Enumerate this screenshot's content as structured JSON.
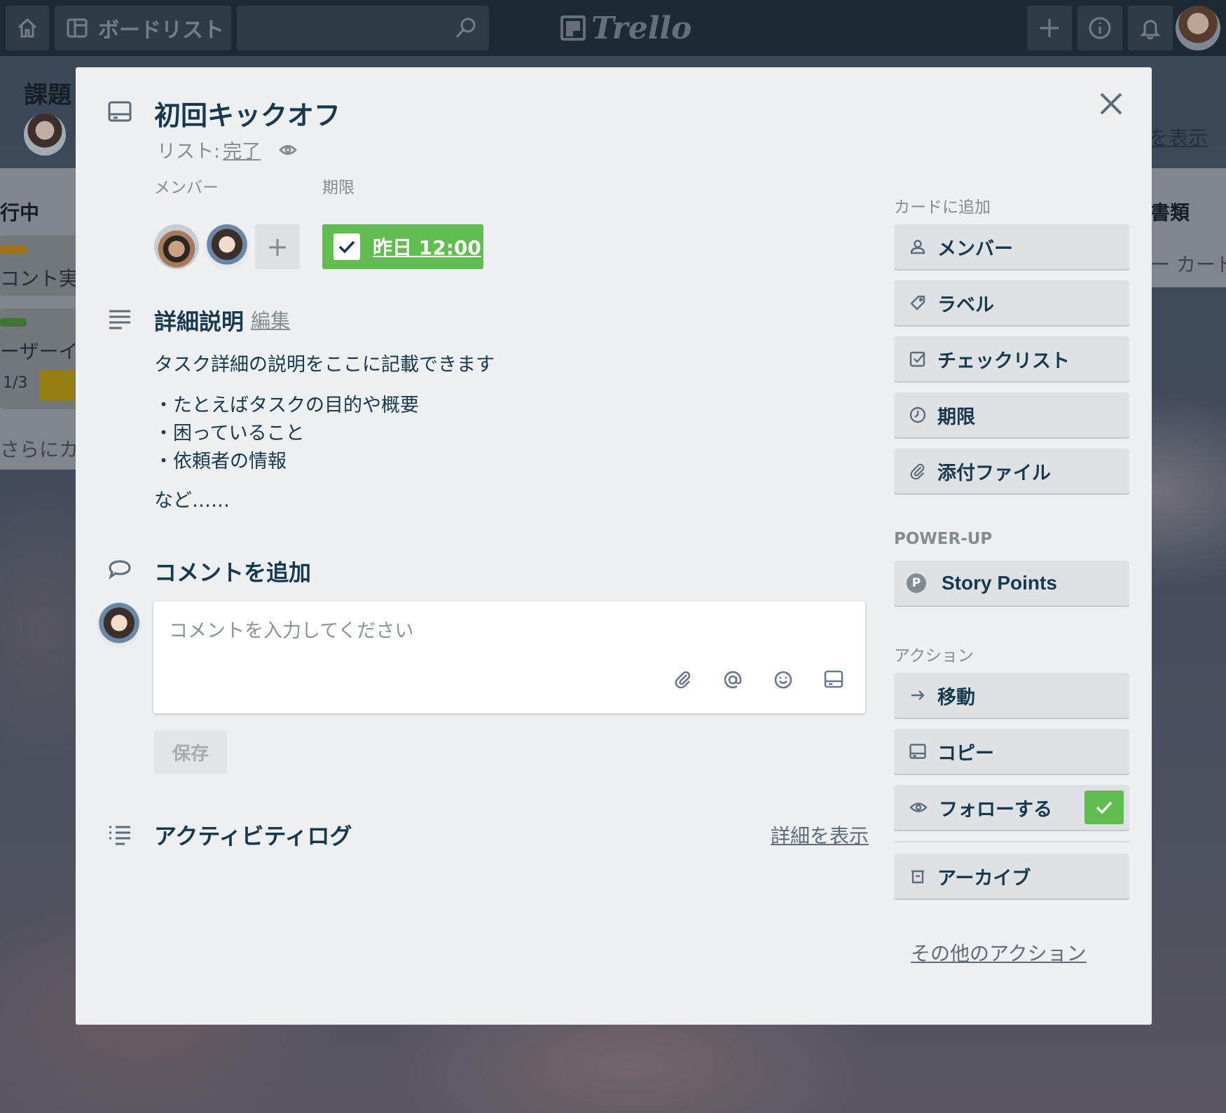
{
  "topbar": {
    "board_list_label": "ボードリスト",
    "logo_text": "Trello",
    "icons": [
      "home-icon",
      "board-icon",
      "search-icon",
      "plus-icon",
      "info-icon",
      "bell-icon"
    ]
  },
  "background": {
    "board_title": "課題",
    "show_menu_link": "を表示",
    "list_left_title": "行中",
    "list_left_card1": "コント実業",
    "list_left_card2": "ーザーイン",
    "list_left_badge": "1/3",
    "list_left_add": "さらにカー",
    "list_right_title": "書類",
    "list_right_add": "ー カード"
  },
  "card": {
    "title": "初回キックオフ",
    "list_prefix": "リスト:",
    "list_name": "完了",
    "members_label": "メンバー",
    "due_label": "期限",
    "due_value": "昨日 12:00",
    "description_title": "詳細説明",
    "description_edit": "編集",
    "description_lines": [
      "タスク詳細の説明をここに記載できます",
      "・たとえばタスクの目的や概要",
      "・困っていること",
      "・依頼者の情報",
      "など……"
    ],
    "comment_title": "コメントを追加",
    "comment_placeholder": "コメントを入力してください",
    "save_label": "保存",
    "activity_title": "アクティビティログ",
    "activity_detail_link": "詳細を表示"
  },
  "sidebar": {
    "add_to_card_label": "カードに追加",
    "add_items": [
      "メンバー",
      "ラベル",
      "チェックリスト",
      "期限",
      "添付ファイル"
    ],
    "powerup_label": "POWER-UP",
    "powerup_badge": "P",
    "powerup_item": "Story Points",
    "actions_label": "アクション",
    "action_items": [
      "移動",
      "コピー",
      "フォローする"
    ],
    "archive_label": "アーカイブ",
    "more_actions": "その他のアクション"
  },
  "colors": {
    "accent_green": "#61bd4f",
    "text_primary": "#17394d",
    "text_muted": "#838c91",
    "dialog_bg": "#edeff0",
    "topbar_bg": "#243442"
  }
}
